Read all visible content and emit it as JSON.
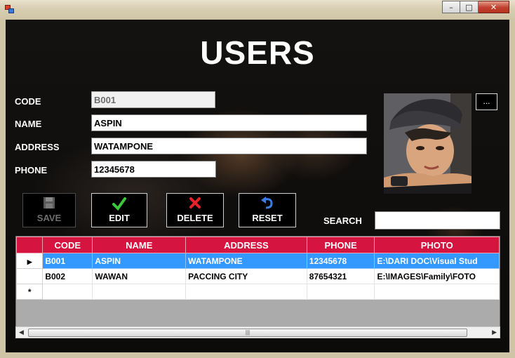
{
  "window": {
    "controls": [
      "minimize-icon",
      "maximize-icon",
      "close-icon"
    ]
  },
  "title": "USERS",
  "form": {
    "code": {
      "label": "CODE",
      "value": "B001"
    },
    "name": {
      "label": "NAME",
      "value": "ASPIN"
    },
    "address": {
      "label": "ADDRESS",
      "value": "WATAMPONE"
    },
    "phone": {
      "label": "PHONE",
      "value": "12345678"
    },
    "browse_label": "..."
  },
  "actions": {
    "save": "SAVE",
    "edit": "EDIT",
    "delete": "DELETE",
    "reset": "RESET"
  },
  "search": {
    "label": "SEARCH",
    "value": ""
  },
  "grid": {
    "columns": [
      "CODE",
      "NAME",
      "ADDRESS",
      "PHONE",
      "PHOTO"
    ],
    "rows": [
      {
        "code": "B001",
        "name": "ASPIN",
        "address": "WATAMPONE",
        "phone": "12345678",
        "photo": "E:\\DARI DOC\\Visual Stud",
        "selected": true
      },
      {
        "code": "B002",
        "name": "WAWAN",
        "address": "PACCING CITY",
        "phone": "87654321",
        "photo": "E:\\IMAGES\\Family\\FOTO",
        "selected": false
      }
    ],
    "new_row_marker": "*"
  },
  "colors": {
    "header": "#d5143f",
    "selection": "#3399ff"
  }
}
